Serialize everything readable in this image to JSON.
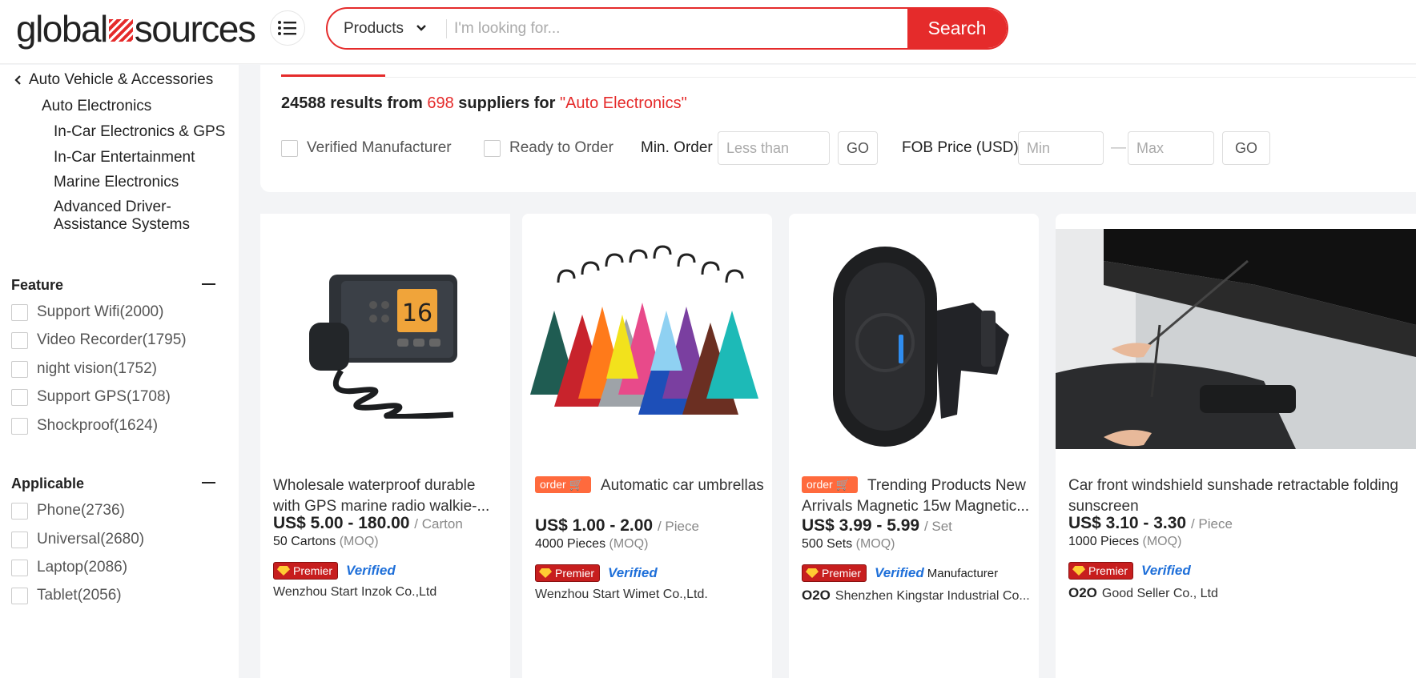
{
  "header": {
    "logo_left": "global",
    "logo_right": "sources",
    "search": {
      "category": "Products",
      "placeholder": "I'm looking for...",
      "button": "Search"
    }
  },
  "sidebar": {
    "back_label": "Auto Vehicle & Accessories",
    "current": "Auto Electronics",
    "subcategories": [
      "In-Car Electronics & GPS",
      "In-Car Entertainment",
      "Marine Electronics",
      "Advanced Driver-Assistance Systems"
    ],
    "facets": [
      {
        "title": "Feature",
        "items": [
          "Support Wifi(2000)",
          "Video Recorder(1795)",
          "night vision(1752)",
          "Support GPS(1708)",
          "Shockproof(1624)"
        ]
      },
      {
        "title": "Applicable",
        "items": [
          "Phone(2736)",
          "Universal(2680)",
          "Laptop(2086)",
          "Tablet(2056)"
        ]
      }
    ]
  },
  "results": {
    "count": "24588",
    "text_from": "results from",
    "suppliers": "698",
    "text_suppliers": "suppliers for",
    "query": "\"Auto Electronics\""
  },
  "filters": {
    "verified_manufacturer": "Verified Manufacturer",
    "ready_to_order": "Ready to Order",
    "min_order_label": "Min. Order",
    "min_order_placeholder": "Less than",
    "go": "GO",
    "fob_label": "FOB Price (USD)",
    "min_placeholder": "Min",
    "dash": "—",
    "max_placeholder": "Max"
  },
  "products": [
    {
      "order_badge": "",
      "title": "Wholesale waterproof durable with GPS marine radio walkie-...",
      "price": "US$ 5.00 - 180.00",
      "unit": "/ Carton",
      "moq_qty": "50 Cartons",
      "moq": "(MOQ)",
      "premier": "Premier",
      "verified": "Verified",
      "verified_extra": "",
      "o2o": "",
      "supplier": "Wenzhou Start Inzok Co.,Ltd"
    },
    {
      "order_badge": "order",
      "title": "Automatic car umbrellas",
      "price": "US$ 1.00 - 2.00",
      "unit": "/ Piece",
      "moq_qty": "4000 Pieces",
      "moq": "(MOQ)",
      "premier": "Premier",
      "verified": "Verified",
      "verified_extra": "",
      "o2o": "",
      "supplier": "Wenzhou Start Wimet Co.,Ltd."
    },
    {
      "order_badge": "order",
      "title": "Trending Products New Arrivals Magnetic 15w Magnetic...",
      "price": "US$ 3.99 - 5.99",
      "unit": "/ Set",
      "moq_qty": "500 Sets",
      "moq": "(MOQ)",
      "premier": "Premier",
      "verified": "Verified",
      "verified_extra": "Manufacturer",
      "o2o": "O2O",
      "supplier": "Shenzhen Kingstar Industrial Co..."
    },
    {
      "order_badge": "",
      "title": "Car front windshield sunshade retractable folding sunscreen",
      "price": "US$ 3.10 - 3.30",
      "unit": "/ Piece",
      "moq_qty": "1000 Pieces",
      "moq": "(MOQ)",
      "premier": "Premier",
      "verified": "Verified",
      "verified_extra": "",
      "o2o": "O2O",
      "supplier": "Good Seller Co., Ltd"
    }
  ],
  "colors": {
    "brand_red": "#e52b2b",
    "verified_blue": "#1e6fd9",
    "order_orange": "#ff6a3d"
  },
  "icons": [
    "menu-list-icon",
    "chevron-down-icon",
    "chevron-left-icon",
    "minus-icon",
    "premier-gem-icon"
  ]
}
